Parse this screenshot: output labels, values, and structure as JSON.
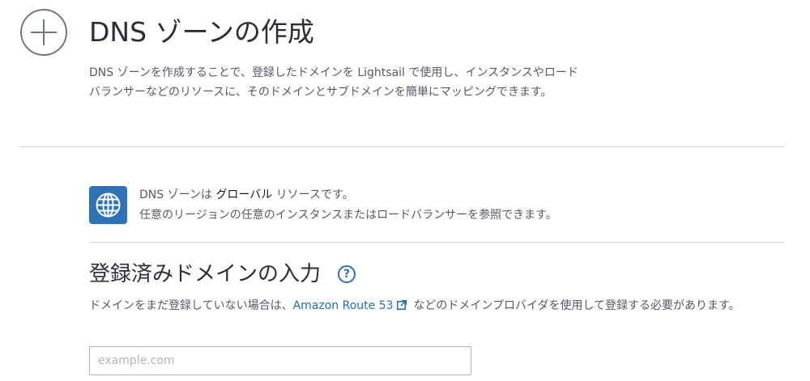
{
  "header": {
    "icon": "plus-circle-icon",
    "title": "DNS ゾーンの作成",
    "description": "DNS ゾーンを作成することで、登録したドメインを Lightsail で使用し、インスタンスやロードバランサーなどのリソースに、そのドメインとサブドメインを簡単にマッピングできます。"
  },
  "info": {
    "icon": "globe-icon",
    "line1_prefix": "DNS ゾーンは",
    "line1_strong": "グローバル",
    "line1_suffix": "リソースです。",
    "line2": "任意のリージョンの任意のインスタンスまたはロードバランサーを参照できます。"
  },
  "domain_section": {
    "title": "登録済みドメインの入力",
    "help_icon": "help-circle-icon",
    "help_glyph": "?",
    "desc_before": "ドメインをまだ登録していない場合は、",
    "link_text": "Amazon Route 53",
    "link_icon": "external-link-icon",
    "desc_after": "などのドメインプロバイダを使用して登録する必要があります。",
    "input_placeholder": "example.com",
    "input_value": ""
  },
  "colors": {
    "accent": "#2e73b8",
    "link": "#1f6fb2",
    "text": "#545b64",
    "heading": "#2a2f35",
    "divider": "#d5dbdb"
  }
}
